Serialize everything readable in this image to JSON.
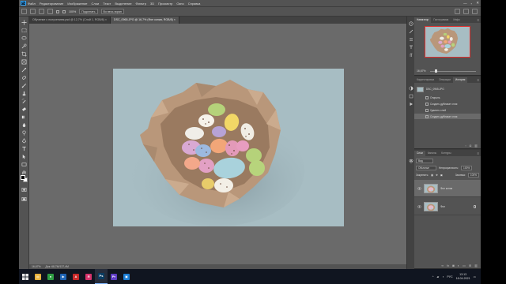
{
  "menubar": {
    "logo": "Ps",
    "items": [
      "Файл",
      "Редактирование",
      "Изображение",
      "Слои",
      "Текст",
      "Выделение",
      "Фильтр",
      "3D",
      "Просмотр",
      "Окно",
      "Справка"
    ],
    "window_controls": [
      "—",
      "▫",
      "✕"
    ]
  },
  "options": {
    "zoom": "100%",
    "buttons": [
      "Подогнать",
      "Во весь экран"
    ]
  },
  "tabs": [
    {
      "label": "Обучение с получением.psd @ 12,7% (Слой 1, RGB/8) ×",
      "active": false
    },
    {
      "label": "DSC_0965.JPG @ 16,7% (Фон копия, RGB/8) ×",
      "active": true
    }
  ],
  "statusbar": {
    "zoom": "16,67%",
    "doc": "Док: 68,7M/137,4M"
  },
  "navigator": {
    "tabs": [
      "Навигатор",
      "Гистограмма",
      "Инфо"
    ],
    "zoom": "16,67%"
  },
  "history": {
    "tabs": [
      "Корректировка",
      "Операции",
      "История"
    ],
    "snapshot_label": "DSC_0965.JPG",
    "steps": [
      "Открыть",
      "Создать дубликат слоя",
      "Удалить слой",
      "Создать дубликат слоя"
    ],
    "active_step": 3
  },
  "layers": {
    "tabs": [
      "Слои",
      "Каналы",
      "Контуры"
    ],
    "filter_label": "Вид",
    "blend_mode": "Обычные",
    "opacity_label": "Непрозрачность:",
    "opacity": "100%",
    "lock_label": "Закрепить:",
    "fill_label": "Заливка:",
    "fill": "100%",
    "items": [
      {
        "name": "Фон копия",
        "active": true,
        "locked": false
      },
      {
        "name": "Фон",
        "active": false,
        "locked": true
      }
    ]
  },
  "taskbar": {
    "apps": [
      {
        "name": "file-explorer",
        "glyph": "▤",
        "color": "#e9b23c",
        "active": false
      },
      {
        "name": "chrome",
        "glyph": "●",
        "color": "#2f9e44",
        "active": false
      },
      {
        "name": "media-player",
        "glyph": "▶",
        "color": "#1e63b5",
        "active": false
      },
      {
        "name": "acrobat",
        "glyph": "A",
        "color": "#c92a2a",
        "active": false
      },
      {
        "name": "yandex-browser",
        "glyph": "Я",
        "color": "#d6336c",
        "active": false
      },
      {
        "name": "photoshop",
        "glyph": "Ps",
        "color": "#0a3d62",
        "active": true
      },
      {
        "name": "premiere",
        "glyph": "Pr",
        "color": "#5f3dc4",
        "active": false
      },
      {
        "name": "windows-app",
        "glyph": "▣",
        "color": "#1c7ed6",
        "active": false
      }
    ],
    "language": "РУС",
    "time": "13:13",
    "date": "18.04.2021"
  },
  "colors": {
    "accent_ps": "#31a8ff",
    "photo_background": "#a7bdc3",
    "navigator_frame": "#e0302e"
  }
}
